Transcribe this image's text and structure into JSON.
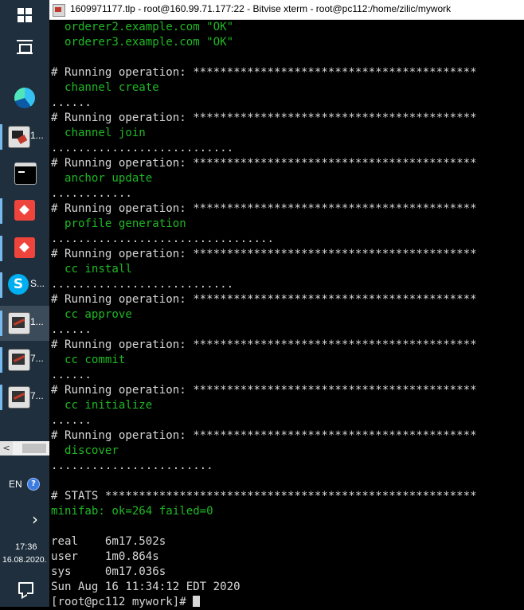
{
  "window": {
    "title": "1609971177.tlp - root@160.99.71.177:22 - Bitvise xterm - root@pc112:/home/zilic/mywork"
  },
  "taskbar": {
    "items": [
      {
        "icon": "edge-icon",
        "label": ""
      },
      {
        "icon": "bitvise-sftp-icon",
        "label": "1..."
      },
      {
        "icon": "terminal-icon",
        "label": ""
      },
      {
        "icon": "anydesk-icon",
        "label": ""
      },
      {
        "icon": "anydesk-icon",
        "label": ""
      },
      {
        "icon": "skype-icon",
        "label": "S..."
      },
      {
        "icon": "bitvise-icon",
        "label": "1..."
      },
      {
        "icon": "bitvise-icon",
        "label": "7..."
      },
      {
        "icon": "bitvise-icon",
        "label": "7..."
      }
    ],
    "language": "EN",
    "help": "?",
    "chevron": "›",
    "time": "17:36",
    "date": "16.08.2020."
  },
  "terminal": {
    "lines": [
      {
        "text": "  orderer2.example.com \"OK\"",
        "color": "#1fb824"
      },
      {
        "text": "  orderer3.example.com \"OK\"",
        "color": "#1fb824"
      },
      {
        "text": "",
        "color": "#d8d8d8"
      },
      {
        "text": "# Running operation: ******************************************",
        "color": "#d8d8d8"
      },
      {
        "text": "  channel create",
        "color": "#1fb824"
      },
      {
        "text": "......",
        "color": "#d8d8d8"
      },
      {
        "text": "# Running operation: ******************************************",
        "color": "#d8d8d8"
      },
      {
        "text": "  channel join",
        "color": "#1fb824"
      },
      {
        "text": "...........................",
        "color": "#d8d8d8"
      },
      {
        "text": "# Running operation: ******************************************",
        "color": "#d8d8d8"
      },
      {
        "text": "  anchor update",
        "color": "#1fb824"
      },
      {
        "text": "............",
        "color": "#d8d8d8"
      },
      {
        "text": "# Running operation: ******************************************",
        "color": "#d8d8d8"
      },
      {
        "text": "  profile generation",
        "color": "#1fb824"
      },
      {
        "text": ".................................",
        "color": "#d8d8d8"
      },
      {
        "text": "# Running operation: ******************************************",
        "color": "#d8d8d8"
      },
      {
        "text": "  cc install",
        "color": "#1fb824"
      },
      {
        "text": "...........................",
        "color": "#d8d8d8"
      },
      {
        "text": "# Running operation: ******************************************",
        "color": "#d8d8d8"
      },
      {
        "text": "  cc approve",
        "color": "#1fb824"
      },
      {
        "text": "......",
        "color": "#d8d8d8"
      },
      {
        "text": "# Running operation: ******************************************",
        "color": "#d8d8d8"
      },
      {
        "text": "  cc commit",
        "color": "#1fb824"
      },
      {
        "text": "......",
        "color": "#d8d8d8"
      },
      {
        "text": "# Running operation: ******************************************",
        "color": "#d8d8d8"
      },
      {
        "text": "  cc initialize",
        "color": "#1fb824"
      },
      {
        "text": "......",
        "color": "#d8d8d8"
      },
      {
        "text": "# Running operation: ******************************************",
        "color": "#d8d8d8"
      },
      {
        "text": "  discover",
        "color": "#1fb824"
      },
      {
        "text": "........................",
        "color": "#d8d8d8"
      },
      {
        "text": "",
        "color": "#d8d8d8"
      },
      {
        "text": "# STATS *******************************************************",
        "color": "#d8d8d8"
      },
      {
        "text": "minifab: ok=264 failed=0",
        "color": "#1fb824"
      },
      {
        "text": "",
        "color": "#d8d8d8"
      },
      {
        "text": "real    6m17.502s",
        "color": "#d8d8d8"
      },
      {
        "text": "user    1m0.864s",
        "color": "#d8d8d8"
      },
      {
        "text": "sys     0m17.036s",
        "color": "#d8d8d8"
      },
      {
        "text": "Sun Aug 16 11:34:12 EDT 2020",
        "color": "#d8d8d8"
      },
      {
        "text": "[root@pc112 mywork]# ",
        "color": "#d8d8d8"
      }
    ]
  }
}
